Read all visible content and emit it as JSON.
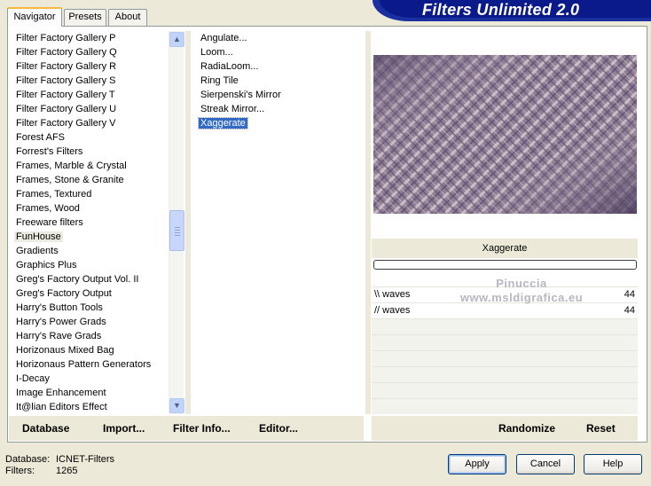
{
  "banner": {
    "title": "Filters Unlimited 2.0"
  },
  "tabs": [
    "Navigator",
    "Presets",
    "About"
  ],
  "categories": [
    "Filter Factory Gallery P",
    "Filter Factory Gallery Q",
    "Filter Factory Gallery R",
    "Filter Factory Gallery S",
    "Filter Factory Gallery T",
    "Filter Factory Gallery U",
    "Filter Factory Gallery V",
    "Forest AFS",
    "Forrest's Filters",
    "Frames, Marble & Crystal",
    "Frames, Stone & Granite",
    "Frames, Textured",
    "Frames, Wood",
    "Freeware filters",
    "FunHouse",
    "Gradients",
    "Graphics Plus",
    "Greg's Factory Output Vol. II",
    "Greg's Factory Output",
    "Harry's Button Tools",
    "Harry's Power Grads",
    "Harry's Rave Grads",
    "Horizonaus Mixed Bag",
    "Horizonaus Pattern Generators",
    "I-Decay",
    "Image Enhancement",
    "It@lian Editors Effect"
  ],
  "selected_category": "FunHouse",
  "filters": [
    "Angulate...",
    "Loom...",
    "RadiaLoom...",
    "Ring Tile",
    "Sierpenski's Mirror",
    "Streak Mirror...",
    "Xaggerate"
  ],
  "selected_filter": "Xaggerate",
  "preview": {
    "filter_name": "Xaggerate"
  },
  "params": [
    {
      "label": "\\\\ waves",
      "value": "44"
    },
    {
      "label": "// waves",
      "value": "44"
    }
  ],
  "watermark": {
    "line1": "Pinuccia",
    "line2": "www.msldigrafica.eu"
  },
  "toolbar": {
    "database": "Database",
    "import": "Import...",
    "filter_info": "Filter Info...",
    "editor": "Editor...",
    "randomize": "Randomize",
    "reset": "Reset"
  },
  "info": {
    "database_label": "Database:",
    "database_value": "ICNET-Filters",
    "filters_label": "Filters:",
    "filters_value": "1265"
  },
  "buttons": {
    "apply": "Apply",
    "cancel": "Cancel",
    "help": "Help"
  },
  "colors": {
    "banner": "#0a1a8a",
    "selection": "#316ac5",
    "preview_dark": "#5a4a6c",
    "preview_light": "#c9b9c2"
  }
}
